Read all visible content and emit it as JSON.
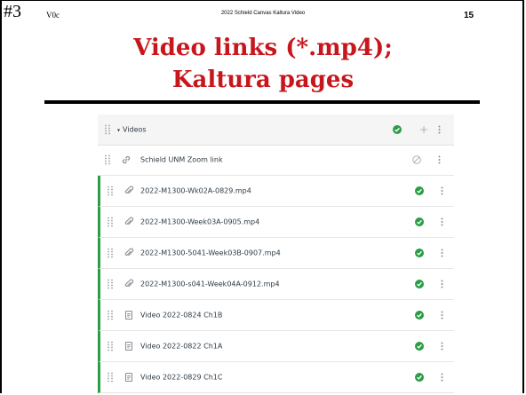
{
  "slide": {
    "number": "#3",
    "version": "V0c",
    "header": "2022 Schield Canvas Kaltura Video",
    "page": "15",
    "title_line1": "Video links (*.mp4);",
    "title_line2": "Kaltura pages",
    "title_color": "#c8161d"
  },
  "module": {
    "title": "Videos",
    "caret": "▾",
    "add_label": "+",
    "status": "published",
    "items": [
      {
        "label": "Schield UNM Zoom link",
        "type": "link-icon",
        "status": "unpublished"
      },
      {
        "label": "2022-M1300-Wk02A-0829.mp4",
        "type": "paperclip-icon",
        "status": "published"
      },
      {
        "label": "2022-M1300-Week03A-0905.mp4",
        "type": "paperclip-icon",
        "status": "published"
      },
      {
        "label": "2022-M1300-5041-Week03B-0907.mp4",
        "type": "paperclip-icon",
        "status": "published"
      },
      {
        "label": "2022-M1300-s041-Week04A-0912.mp4",
        "type": "paperclip-icon",
        "status": "published"
      },
      {
        "label": "Video 2022-0824 Ch1B",
        "type": "page-icon",
        "status": "published"
      },
      {
        "label": "Video 2022-0822 Ch1A",
        "type": "page-icon",
        "status": "published"
      },
      {
        "label": "Video 2022-0829 Ch1C",
        "type": "page-icon",
        "status": "published"
      }
    ]
  },
  "colors": {
    "published": "#2a9d45",
    "unpublished": "#b0b0b0",
    "text": "#2d3b45"
  }
}
